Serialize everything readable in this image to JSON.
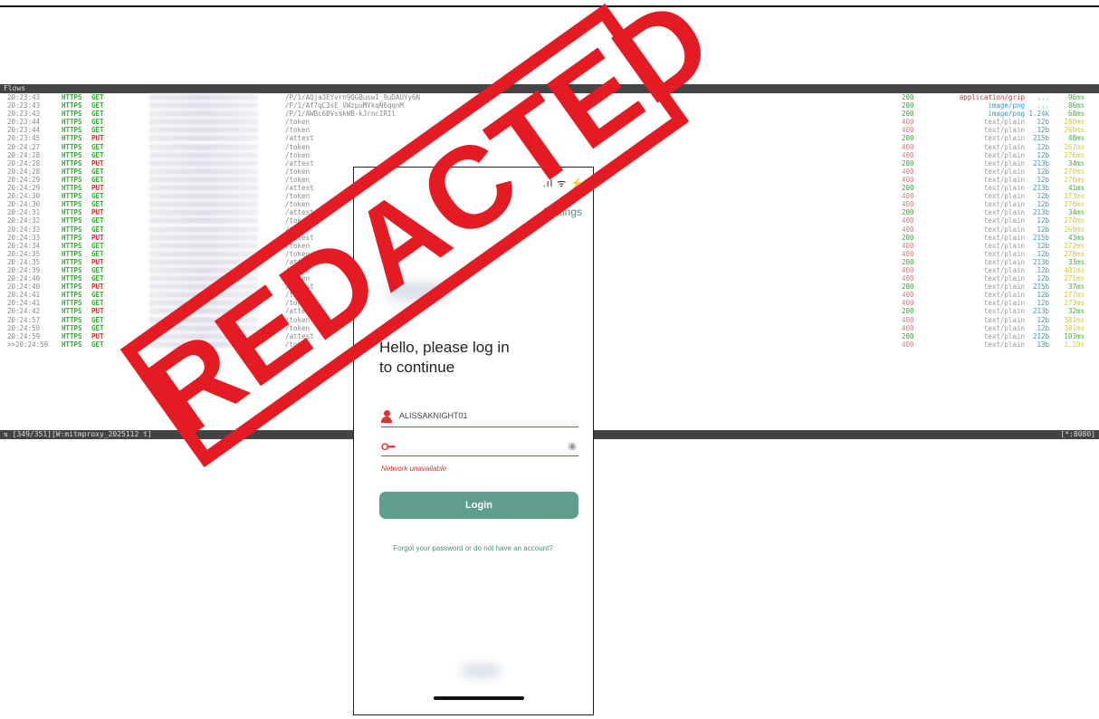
{
  "terminal": {
    "header": "Flows",
    "statusbar_left": "⇅ [349/351][W:mitmproxy_2025112 t]",
    "statusbar_right": "[*:8080]",
    "rows": [
      {
        "time": "20:23:43",
        "proto": "HTTPS",
        "method": "GET",
        "path": "/P/1/AQja3EYvrn9QGBuswI_9uDAUYy6N",
        "code": "200",
        "type": "application/grip",
        "size": "...",
        "dur": "96ms",
        "ttype": "app"
      },
      {
        "time": "20:23:43",
        "proto": "HTTPS",
        "method": "GET",
        "path": "/P/1/Af7qC3sE_VWzpuMYkqN6qqnM",
        "code": "200",
        "type": "image/png",
        "size": "...",
        "dur": "86ms",
        "ttype": "img"
      },
      {
        "time": "20:23:43",
        "proto": "HTTPS",
        "method": "GET",
        "path": "/P/1/AWBc6BVs$kWB-kJrncIRIl",
        "code": "200",
        "type": "image/png",
        "size": "1.24k",
        "dur": "68ms",
        "ttype": "img"
      },
      {
        "time": "20:23:44",
        "proto": "HTTPS",
        "method": "GET",
        "path": "/token",
        "code": "400",
        "type": "text/plain",
        "size": "12b",
        "dur": "280ms",
        "ttype": "txt"
      },
      {
        "time": "20:23:44",
        "proto": "HTTPS",
        "method": "GET",
        "path": "/token",
        "code": "400",
        "type": "text/plain",
        "size": "12b",
        "dur": "260ms",
        "ttype": "txt"
      },
      {
        "time": "20:23:45",
        "proto": "HTTPS",
        "method": "PUT",
        "path": "/attest",
        "code": "200",
        "type": "text/plain",
        "size": "215b",
        "dur": "48ms",
        "ttype": "txt"
      },
      {
        "time": "20:24:27",
        "proto": "HTTPS",
        "method": "GET",
        "path": "/token",
        "code": "400",
        "type": "text/plain",
        "size": "12b",
        "dur": "267ms",
        "ttype": "txt"
      },
      {
        "time": "20:24:28",
        "proto": "HTTPS",
        "method": "GET",
        "path": "/token",
        "code": "400",
        "type": "text/plain",
        "size": "12b",
        "dur": "276ms",
        "ttype": "txt"
      },
      {
        "time": "20:24:28",
        "proto": "HTTPS",
        "method": "PUT",
        "path": "/attest",
        "code": "200",
        "type": "text/plain",
        "size": "213b",
        "dur": "34ms",
        "ttype": "txt"
      },
      {
        "time": "20:24:28",
        "proto": "HTTPS",
        "method": "GET",
        "path": "/token",
        "code": "400",
        "type": "text/plain",
        "size": "12b",
        "dur": "270ms",
        "ttype": "txt"
      },
      {
        "time": "20:24:29",
        "proto": "HTTPS",
        "method": "GET",
        "path": "/token",
        "code": "400",
        "type": "text/plain",
        "size": "12b",
        "dur": "276ms",
        "ttype": "txt"
      },
      {
        "time": "20:24:29",
        "proto": "HTTPS",
        "method": "PUT",
        "path": "/attest",
        "code": "200",
        "type": "text/plain",
        "size": "213b",
        "dur": "41ms",
        "ttype": "txt"
      },
      {
        "time": "20:24:30",
        "proto": "HTTPS",
        "method": "GET",
        "path": "/token",
        "code": "400",
        "type": "text/plain",
        "size": "12b",
        "dur": "273ms",
        "ttype": "txt"
      },
      {
        "time": "20:24:30",
        "proto": "HTTPS",
        "method": "GET",
        "path": "/token",
        "code": "400",
        "type": "text/plain",
        "size": "12b",
        "dur": "278ms",
        "ttype": "txt"
      },
      {
        "time": "20:24:31",
        "proto": "HTTPS",
        "method": "PUT",
        "path": "/attest",
        "code": "200",
        "type": "text/plain",
        "size": "213b",
        "dur": "34ms",
        "ttype": "txt"
      },
      {
        "time": "20:24:32",
        "proto": "HTTPS",
        "method": "GET",
        "path": "/token",
        "code": "400",
        "type": "text/plain",
        "size": "12b",
        "dur": "270ms",
        "ttype": "txt"
      },
      {
        "time": "20:24:33",
        "proto": "HTTPS",
        "method": "GET",
        "path": "/token",
        "code": "400",
        "type": "text/plain",
        "size": "12b",
        "dur": "269ms",
        "ttype": "txt"
      },
      {
        "time": "20:24:33",
        "proto": "HTTPS",
        "method": "PUT",
        "path": "/attest",
        "code": "200",
        "type": "text/plain",
        "size": "215b",
        "dur": "43ms",
        "ttype": "txt"
      },
      {
        "time": "20:24:34",
        "proto": "HTTPS",
        "method": "GET",
        "path": "/token",
        "code": "400",
        "type": "text/plain",
        "size": "12b",
        "dur": "272ms",
        "ttype": "txt"
      },
      {
        "time": "20:24:35",
        "proto": "HTTPS",
        "method": "GET",
        "path": "/token",
        "code": "400",
        "type": "text/plain",
        "size": "12b",
        "dur": "278ms",
        "ttype": "txt"
      },
      {
        "time": "20:24:35",
        "proto": "HTTPS",
        "method": "PUT",
        "path": "/attest",
        "code": "200",
        "type": "text/plain",
        "size": "213b",
        "dur": "33ms",
        "ttype": "txt"
      },
      {
        "time": "20:24:39",
        "proto": "HTTPS",
        "method": "GET",
        "path": "/token",
        "code": "400",
        "type": "text/plain",
        "size": "12b",
        "dur": "401ms",
        "ttype": "txt"
      },
      {
        "time": "20:24:40",
        "proto": "HTTPS",
        "method": "GET",
        "path": "/token",
        "code": "400",
        "type": "text/plain",
        "size": "12b",
        "dur": "271ms",
        "ttype": "txt"
      },
      {
        "time": "20:24:40",
        "proto": "HTTPS",
        "method": "PUT",
        "path": "/attest",
        "code": "200",
        "type": "text/plain",
        "size": "215b",
        "dur": "37ms",
        "ttype": "txt"
      },
      {
        "time": "20:24:41",
        "proto": "HTTPS",
        "method": "GET",
        "path": "/token",
        "code": "400",
        "type": "text/plain",
        "size": "12b",
        "dur": "277ms",
        "ttype": "txt"
      },
      {
        "time": "20:24:41",
        "proto": "HTTPS",
        "method": "GET",
        "path": "/token",
        "code": "400",
        "type": "text/plain",
        "size": "12b",
        "dur": "273ms",
        "ttype": "txt"
      },
      {
        "time": "20:24:42",
        "proto": "HTTPS",
        "method": "PUT",
        "path": "/attest",
        "code": "200",
        "type": "text/plain",
        "size": "213b",
        "dur": "32ms",
        "ttype": "txt"
      },
      {
        "time": "20:24:57",
        "proto": "HTTPS",
        "method": "GET",
        "path": "/token",
        "code": "400",
        "type": "text/plain",
        "size": "12b",
        "dur": "381ms",
        "ttype": "txt"
      },
      {
        "time": "20:24:58",
        "proto": "HTTPS",
        "method": "GET",
        "path": "/token",
        "code": "400",
        "type": "text/plain",
        "size": "12b",
        "dur": "381ms",
        "ttype": "txt"
      },
      {
        "time": "20:24:59",
        "proto": "HTTPS",
        "method": "PUT",
        "path": "/attest",
        "code": "200",
        "type": "text/plain",
        "size": "212b",
        "dur": "103ms",
        "ttype": "txt"
      },
      {
        "time": ">>20:24:59",
        "proto": "HTTPS",
        "method": "GET",
        "path": "/token",
        "code": "400",
        "type": "text/plain",
        "size": "13b",
        "dur": "1.20s",
        "ttype": "txt"
      }
    ]
  },
  "phone": {
    "status_icons": ".ıl ᯤ ⚡",
    "settings_label": "Settings",
    "greeting_line1": "Hello, please log in",
    "greeting_line2": "to continue",
    "username_value": "ALISSAKNIGHT01",
    "password_key_icon": "key-icon",
    "eye_icon": "eye-icon",
    "error_text": "Network unavailable",
    "login_label": "Login",
    "forgot_text": "Forgot your password or do not have an account?"
  },
  "stamp": {
    "text": "REDACTED",
    "color": "#e51b24"
  },
  "colors": {
    "accent_green": "#5f9d8c",
    "error_red": "#dd3333"
  }
}
